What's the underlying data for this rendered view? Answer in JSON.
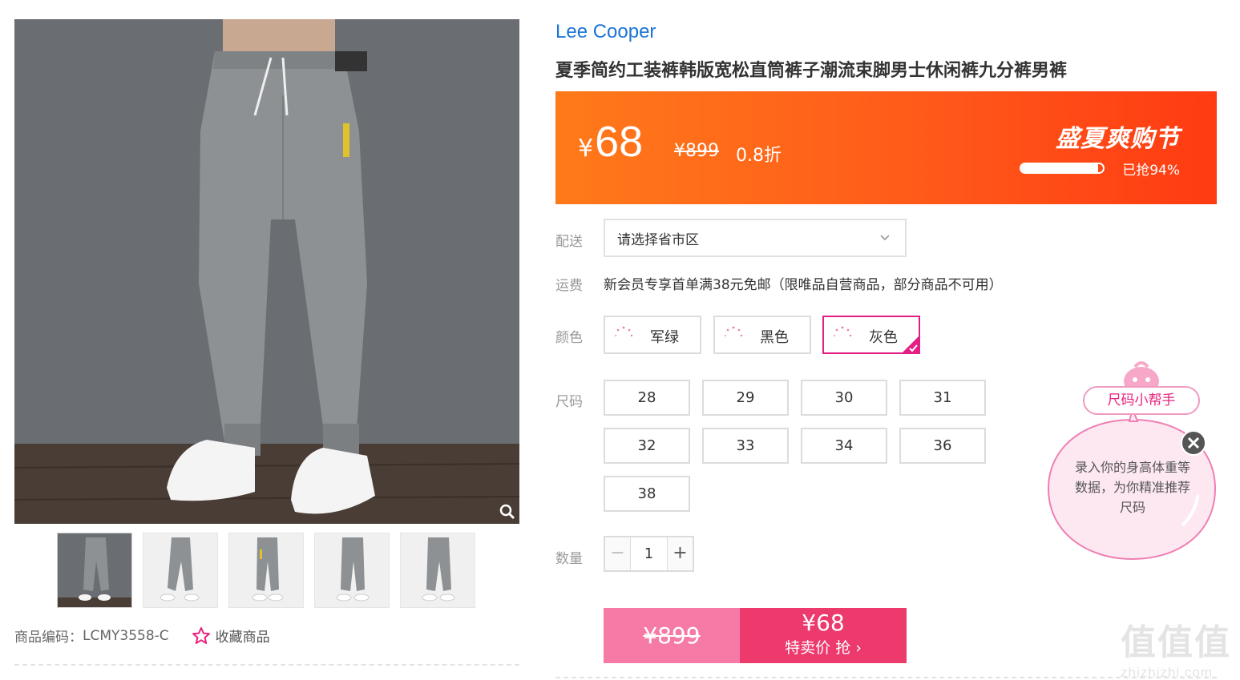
{
  "product": {
    "brand": "Lee Cooper",
    "title": "夏季简约工装裤韩版宽松直筒裤子潮流束脚男士休闲裤九分裤男裤",
    "sku_label": "商品编码：",
    "sku": "LCMY3558-C",
    "favorite_label": "收藏商品"
  },
  "price": {
    "currency": "¥",
    "now": "68",
    "old": "¥899",
    "discount": "0.8折",
    "event": "盛夏爽购节",
    "sold_text": "已抢94%",
    "sold_fraction": 0.94
  },
  "delivery": {
    "label": "配送",
    "placeholder": "请选择省市区"
  },
  "shipping": {
    "label": "运费",
    "text": "新会员专享首单满38元免邮（限唯品自营商品，部分商品不可用）"
  },
  "color": {
    "label": "颜色",
    "options": [
      "军绿",
      "黑色",
      "灰色"
    ],
    "selected": "灰色"
  },
  "size": {
    "label": "尺码",
    "options": [
      "28",
      "29",
      "30",
      "31",
      "32",
      "33",
      "34",
      "36",
      "38"
    ]
  },
  "quantity": {
    "label": "数量",
    "value": "1",
    "minus": "−",
    "plus": "+"
  },
  "buy": {
    "old_price": "¥899",
    "price": "¥68",
    "action": "特卖价 抢 ›"
  },
  "helper": {
    "tag": "尺码小帮手",
    "text": "录入你的身高体重等数据，为你精准推荐尺码"
  },
  "watermark": {
    "big": "值值值",
    "small": "zhizhizhi.com"
  },
  "colors": {
    "accent": "#e31f85",
    "brand_blue": "#1a73d6",
    "banner_orange": "#ff5a1a",
    "buy_pink": "#ec3a6d"
  }
}
